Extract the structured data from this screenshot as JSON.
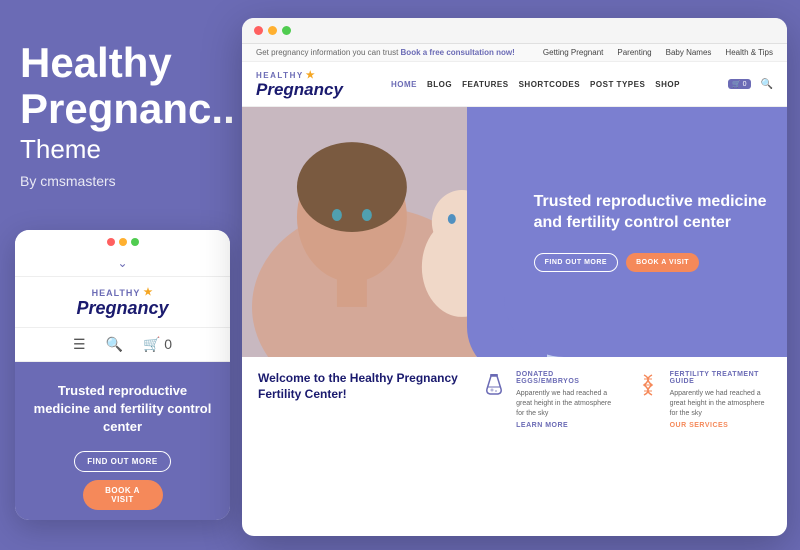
{
  "left": {
    "title_line1": "Healthy",
    "title_line2": "Pregnanc..",
    "theme": "Theme",
    "by": "By cmsmasters"
  },
  "mobile": {
    "logo_healthy": "HEALTHY",
    "logo_star": "★",
    "logo_pregnancy": "Pregnancy",
    "hero_text": "Trusted reproductive medicine and fertility control center",
    "btn_find_out": "FIND OUT MORE",
    "btn_book": "BOOK A VISIT"
  },
  "desktop": {
    "info_bar": {
      "left_text": "Get pregnancy information you can trust",
      "left_link": "Book a free consultation now!",
      "nav_items": [
        "Getting Pregnant",
        "Parenting",
        "Baby Names",
        "Health & Tips"
      ]
    },
    "nav": {
      "logo_healthy": "HEALTHY",
      "logo_star": "★",
      "logo_pregnancy": "Pregnancy",
      "links": [
        "HOME",
        "BLOG",
        "FEATURES",
        "SHORTCODES",
        "POST TYPES",
        "SHOP"
      ],
      "cart": "🛒 0"
    },
    "hero": {
      "title": "Trusted reproductive medicine and fertility control center",
      "btn_find_out": "FIND OUT MORE",
      "btn_book": "BOOK A VISIT"
    },
    "bottom": {
      "welcome_title": "Welcome to the Healthy Pregnancy Fertility Center!",
      "card1": {
        "category": "DONATED EGGS/EMBRYOS",
        "text": "Apparently we had reached a great height in the atmosphere for the sky",
        "link": "LEARN MORE"
      },
      "card2": {
        "category": "FERTILITY TREATMENT GUIDE",
        "text": "Apparently we had reached a great height in the atmosphere for the sky",
        "link": "OUR SERVICES"
      }
    }
  }
}
